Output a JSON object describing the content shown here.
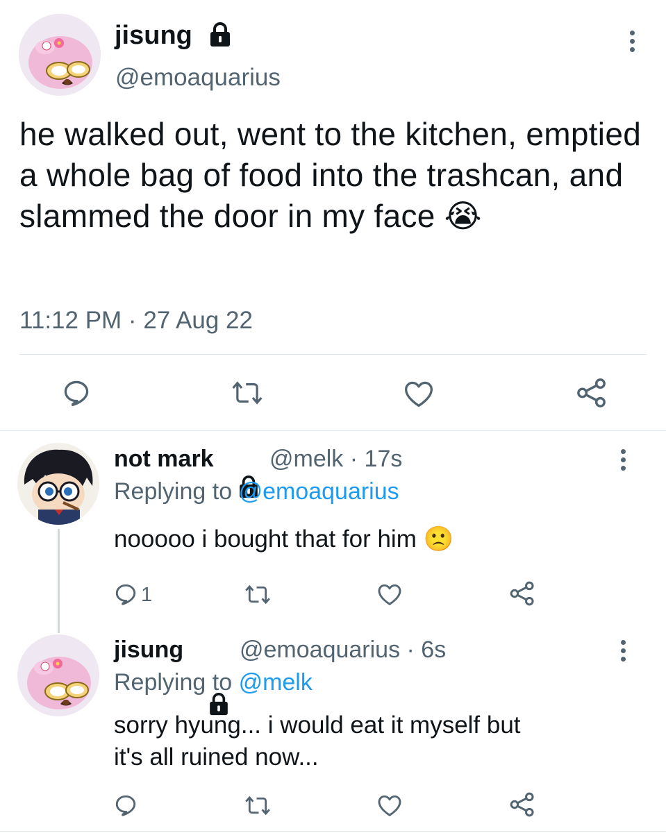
{
  "main_tweet": {
    "display_name": "jisung",
    "handle": "@emoaquarius",
    "text": "he walked out, went to the kitchen, emptied a whole bag of food into the trashcan, and slammed the door in my face 😭",
    "timestamp": "11:12 PM · 27 Aug 22"
  },
  "replies": [
    {
      "display_name": "not mark",
      "handle": "@melk",
      "time": "· 17s",
      "replying_label": "Replying to",
      "replying_to": "@emoaquarius",
      "text": "nooooo i bought that for him 🙁",
      "reply_count": "1"
    },
    {
      "display_name": "jisung",
      "handle": "@emoaquarius",
      "time": "· 6s",
      "replying_label": "Replying to",
      "replying_to": "@melk",
      "text_line1": "sorry hyung... i would eat it myself but",
      "text_line2": "it's all ruined now...",
      "reply_count": ""
    }
  ],
  "icons": [
    "lock-icon",
    "more-icon",
    "reply-icon",
    "retweet-icon",
    "like-icon",
    "share-icon"
  ],
  "colors": {
    "text": "#0f1419",
    "muted": "#536471",
    "link": "#1d9bf0",
    "divider": "#e1e8ed",
    "thread": "#cfd9de"
  }
}
